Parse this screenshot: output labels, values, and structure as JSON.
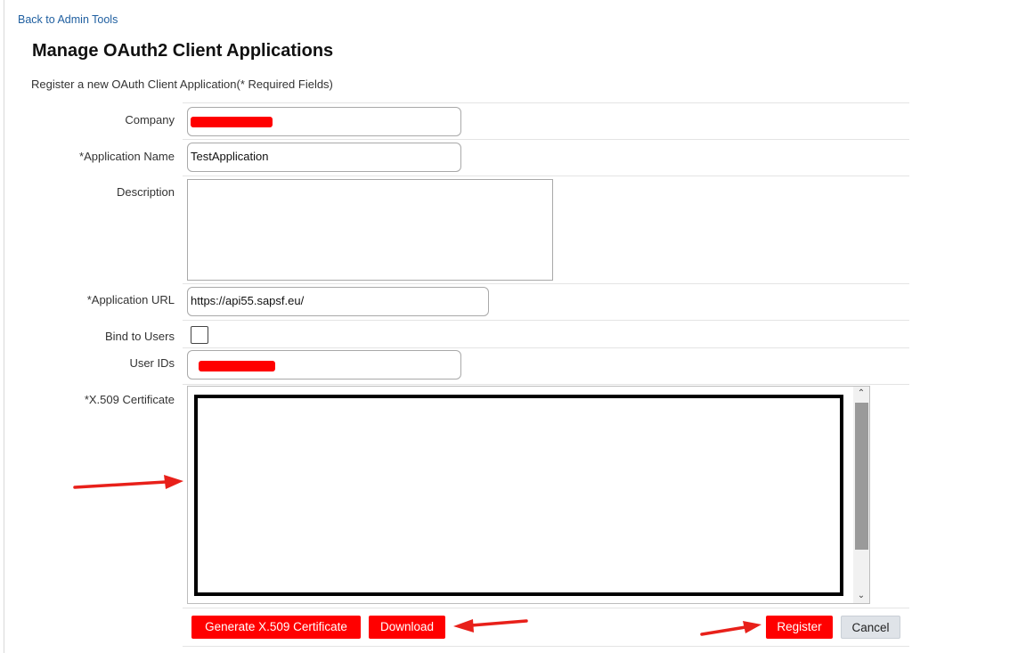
{
  "nav": {
    "back_link": "Back to Admin Tools"
  },
  "page": {
    "title": "Manage OAuth2 Client Applications",
    "subtitle": "Register a new OAuth Client Application(* Required Fields)"
  },
  "form": {
    "company": {
      "label": "Company",
      "value": ""
    },
    "application_name": {
      "label": "*Application Name",
      "value": "TestApplication"
    },
    "description": {
      "label": "Description",
      "value": ""
    },
    "application_url": {
      "label": "*Application URL",
      "value": "https://api55.sapsf.eu/"
    },
    "bind_to_users": {
      "label": "Bind to Users",
      "checked": false
    },
    "user_ids": {
      "label": "User IDs",
      "value": ""
    },
    "certificate": {
      "label": "*X.509 Certificate",
      "value": ""
    }
  },
  "buttons": {
    "generate": "Generate X.509 Certificate",
    "download": "Download",
    "register": "Register",
    "cancel": "Cancel"
  },
  "icons": {
    "scroll_up": "chevron-up-icon",
    "scroll_down": "chevron-down-icon",
    "annotation_arrow": "red-arrow-icon"
  },
  "colors": {
    "primary_button": "#ff0000",
    "secondary_button": "#dfe3e8",
    "link": "#1f5fa0",
    "annotation": "#e8201a"
  }
}
